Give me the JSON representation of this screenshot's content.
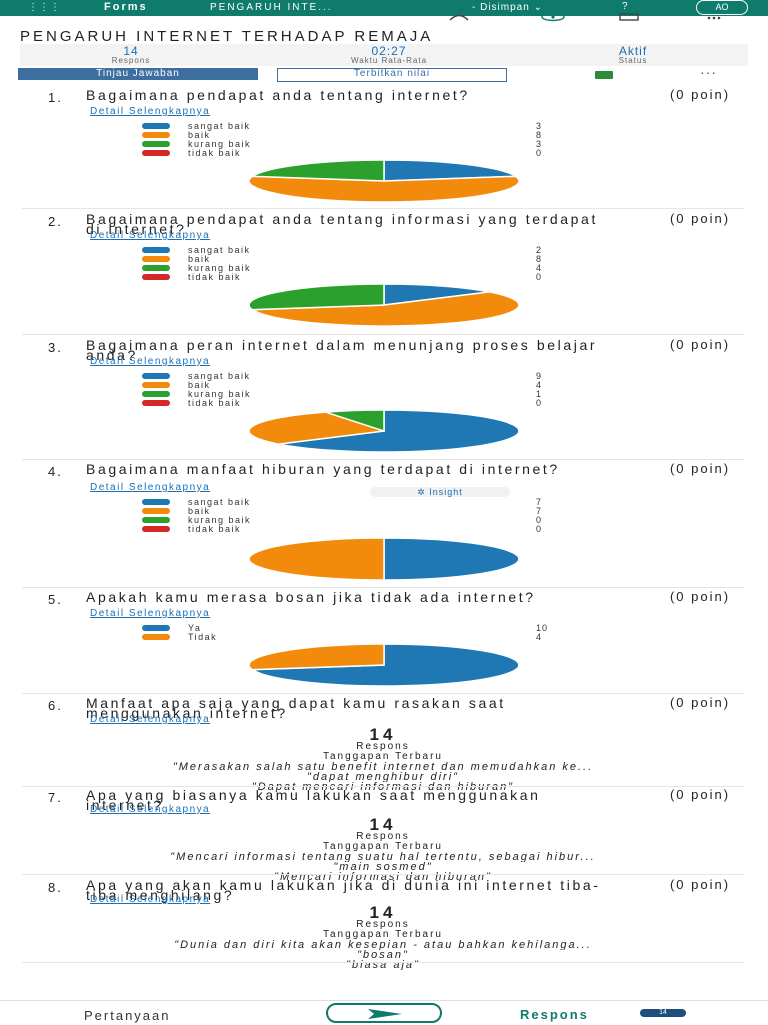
{
  "topbar": {
    "waffle": "⋮⋮⋮",
    "app_name": "Forms",
    "doc_title": "PENGARUH INTE...",
    "saved_status": "- Disimpan ⌄",
    "help": "?",
    "avatar": "AO"
  },
  "toolbar_icons": [
    "share-icon",
    "present-icon",
    "device-icon",
    "more-icon"
  ],
  "form_title": "PENGARUH INTERNET TERHADAP REMAJA",
  "stats": [
    {
      "value": "14",
      "label": "Respons"
    },
    {
      "value": "02:27",
      "label": "Waktu Rata-Rata"
    },
    {
      "value": "Aktif",
      "label": "Status"
    }
  ],
  "buttons": {
    "review": "Tinjau Jawaban",
    "publish": "Terbitkan nilai",
    "more": "···"
  },
  "colors": {
    "sangat_baik": "#1f77b4",
    "baik": "#f28a0b",
    "kurang_baik": "#2ca02c",
    "tidak_baik": "#d62728",
    "accent": "#0f7b6c",
    "link": "#1a6fb5"
  },
  "questions": [
    {
      "num": "1.",
      "text": "Bagaimana pendapat anda tentang internet?",
      "points": "(0 poin)",
      "detail": "Detail Selengkapnya",
      "options": [
        {
          "label": "sangat baik",
          "count": 3,
          "color": "#1f77b4"
        },
        {
          "label": "baik",
          "count": 8,
          "color": "#f28a0b"
        },
        {
          "label": "kurang baik",
          "count": 3,
          "color": "#2ca02c"
        },
        {
          "label": "tidak baik",
          "count": 0,
          "color": "#d62728"
        }
      ]
    },
    {
      "num": "2.",
      "text": "Bagaimana pendapat anda tentang informasi yang terdapat di internet?",
      "points": "(0 poin)",
      "detail": "Detail Selengkapnya",
      "options": [
        {
          "label": "sangat baik",
          "count": 2,
          "color": "#1f77b4"
        },
        {
          "label": "baik",
          "count": 8,
          "color": "#f28a0b"
        },
        {
          "label": "kurang baik",
          "count": 4,
          "color": "#2ca02c"
        },
        {
          "label": "tidak baik",
          "count": 0,
          "color": "#d62728"
        }
      ]
    },
    {
      "num": "3.",
      "text": "Bagaimana peran internet dalam menunjang proses belajar anda?",
      "points": "(0 poin)",
      "detail": "Detail Selengkapnya",
      "options": [
        {
          "label": "sangat baik",
          "count": 9,
          "color": "#1f77b4"
        },
        {
          "label": "baik",
          "count": 4,
          "color": "#f28a0b"
        },
        {
          "label": "kurang baik",
          "count": 1,
          "color": "#2ca02c"
        },
        {
          "label": "tidak baik",
          "count": 0,
          "color": "#d62728"
        }
      ]
    },
    {
      "num": "4.",
      "text": "Bagaimana manfaat hiburan yang terdapat di internet?",
      "points": "(0 poin)",
      "detail": "Detail Selengkapnya",
      "insight": "Insight",
      "options": [
        {
          "label": "sangat baik",
          "count": 7,
          "color": "#1f77b4"
        },
        {
          "label": "baik",
          "count": 7,
          "color": "#f28a0b"
        },
        {
          "label": "kurang baik",
          "count": 0,
          "color": "#2ca02c"
        },
        {
          "label": "tidak baik",
          "count": 0,
          "color": "#d62728"
        }
      ]
    },
    {
      "num": "5.",
      "text": "Apakah kamu merasa bosan jika tidak ada internet?",
      "points": "(0 poin)",
      "detail": "Detail Selengkapnya",
      "options": [
        {
          "label": "Ya",
          "count": 10,
          "color": "#1f77b4"
        },
        {
          "label": "Tidak",
          "count": 4,
          "color": "#f28a0b"
        }
      ]
    },
    {
      "num": "6.",
      "text": "Manfaat apa saja yang dapat kamu rasakan saat menggunakan internet?",
      "points": "(0 poin)",
      "detail": "Detail Selengkapnya",
      "responses": "14",
      "responses_label": "Respons",
      "latest_label": "Tanggapan Terbaru",
      "latest": [
        "\"Merasakan salah satu benefit internet dan memudahkan ke...",
        "\"dapat menghibur diri\"",
        "\"Dapat mencari informasi dan hiburan\""
      ]
    },
    {
      "num": "7.",
      "text": "Apa yang biasanya kamu lakukan saat menggunakan internet?",
      "points": "(0 poin)",
      "detail": "Detail Selengkapnya",
      "responses": "14",
      "responses_label": "Respons",
      "latest_label": "Tanggapan Terbaru",
      "latest": [
        "\"Mencari informasi tentang suatu hal tertentu, sebagai hibur...",
        "\"main sosmed\"",
        "\"Mencari informasi dan hiburan\""
      ]
    },
    {
      "num": "8.",
      "text": "Apa yang akan kamu lakukan jika di dunia ini internet tiba-tiba menghilang?",
      "points": "(0 poin)",
      "detail": "Detail Selengkapnya",
      "responses": "14",
      "responses_label": "Respons",
      "latest_label": "Tanggapan Terbaru",
      "latest": [
        "\"Dunia dan diri kita akan kesepian - atau bahkan kehilanga...",
        "\"bosan\"",
        "\"biasa aja\""
      ]
    }
  ],
  "bottom_nav": {
    "questions_tab": "Pertanyaan",
    "responses_tab": "Respons",
    "responses_badge": "14"
  },
  "chart_data": [
    {
      "type": "pie",
      "categories": [
        "sangat baik",
        "baik",
        "kurang baik",
        "tidak baik"
      ],
      "values": [
        3,
        8,
        3,
        0
      ]
    },
    {
      "type": "pie",
      "categories": [
        "sangat baik",
        "baik",
        "kurang baik",
        "tidak baik"
      ],
      "values": [
        2,
        8,
        4,
        0
      ]
    },
    {
      "type": "pie",
      "categories": [
        "sangat baik",
        "baik",
        "kurang baik",
        "tidak baik"
      ],
      "values": [
        9,
        4,
        1,
        0
      ]
    },
    {
      "type": "pie",
      "categories": [
        "sangat baik",
        "baik",
        "kurang baik",
        "tidak baik"
      ],
      "values": [
        7,
        7,
        0,
        0
      ]
    },
    {
      "type": "pie",
      "categories": [
        "Ya",
        "Tidak"
      ],
      "values": [
        10,
        4
      ]
    }
  ]
}
